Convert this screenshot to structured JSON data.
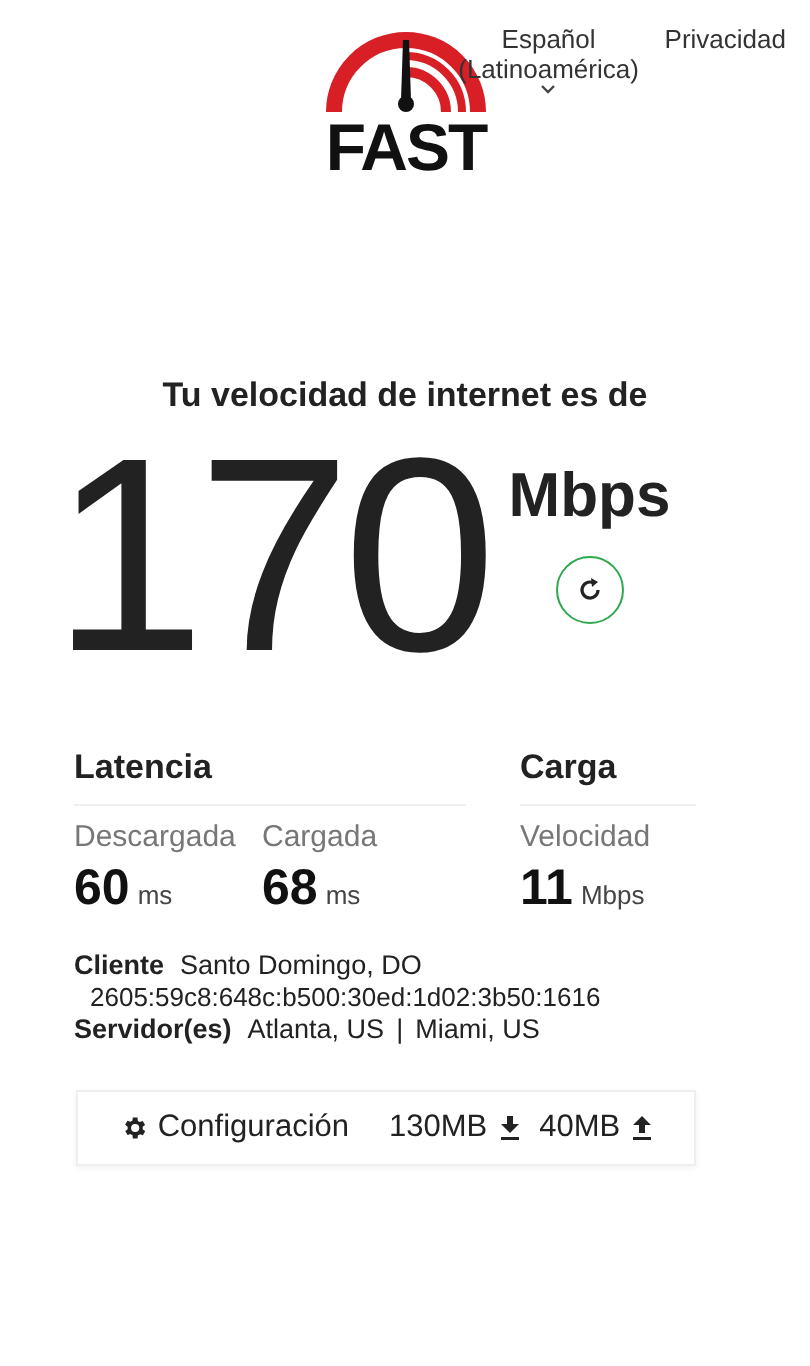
{
  "header": {
    "logo_text": "FAST",
    "language": "Español (Latinoamérica)",
    "privacy_link": "Privacidad"
  },
  "speed": {
    "heading": "Tu velocidad de internet es de",
    "value": "170",
    "unit": "Mbps"
  },
  "latency": {
    "title": "Latencia",
    "metrics": [
      {
        "label": "Descargada",
        "value": "60",
        "unit": "ms"
      },
      {
        "label": "Cargada",
        "value": "68",
        "unit": "ms"
      }
    ]
  },
  "upload": {
    "title": "Carga",
    "metrics": [
      {
        "label": "Velocidad",
        "value": "11",
        "unit": "Mbps"
      }
    ]
  },
  "client": {
    "label": "Cliente",
    "location": "Santo Domingo, DO",
    "ip": "2605:59c8:648c:b500:30ed:1d02:3b50:1616"
  },
  "servers": {
    "label": "Servidor(es)",
    "items": [
      "Atlanta, US",
      "Miami, US"
    ],
    "separator": "|"
  },
  "settings": {
    "label": "Configuración",
    "download_size": "130MB",
    "upload_size": "40MB"
  }
}
